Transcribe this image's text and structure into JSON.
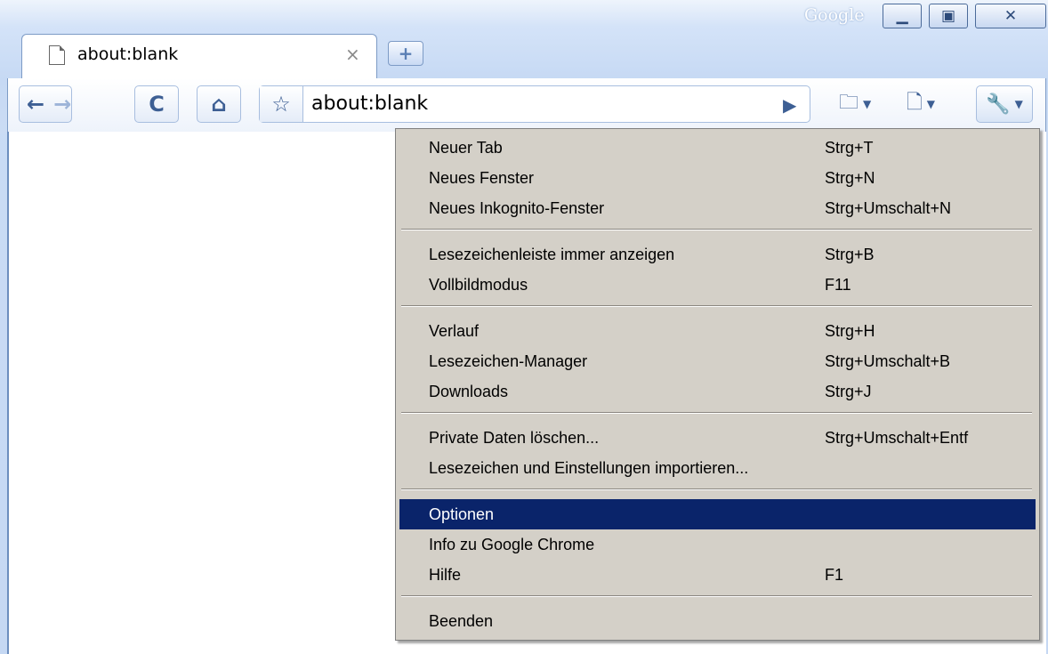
{
  "window": {
    "brand": "Google",
    "minimize_icon": "minimize-icon",
    "maximize_icon": "maximize-icon",
    "close_icon": "close-icon"
  },
  "tab": {
    "title": "about:blank",
    "close_glyph": "×",
    "new_tab_glyph": "+"
  },
  "toolbar": {
    "omnibox_value": "about:blank",
    "back_icon": "back-arrow-icon",
    "forward_icon": "forward-arrow-icon",
    "reload_icon": "reload-icon",
    "home_icon": "home-icon",
    "star_icon": "star-icon",
    "go_icon": "go-icon",
    "bookmark_icon": "bookmark-page-icon",
    "page_icon": "page-menu-icon",
    "wrench_icon": "wrench-icon"
  },
  "menu": {
    "items": [
      {
        "label": "Neuer Tab",
        "shortcut": "Strg+T"
      },
      {
        "label": "Neues Fenster",
        "shortcut": "Strg+N"
      },
      {
        "label": "Neues Inkognito-Fenster",
        "shortcut": "Strg+Umschalt+N"
      },
      {
        "label": "Lesezeichenleiste immer anzeigen",
        "shortcut": "Strg+B"
      },
      {
        "label": "Vollbildmodus",
        "shortcut": "F11"
      },
      {
        "label": "Verlauf",
        "shortcut": "Strg+H"
      },
      {
        "label": "Lesezeichen-Manager",
        "shortcut": "Strg+Umschalt+B"
      },
      {
        "label": "Downloads",
        "shortcut": "Strg+J"
      },
      {
        "label": "Private Daten löschen...",
        "shortcut": "Strg+Umschalt+Entf"
      },
      {
        "label": "Lesezeichen und Einstellungen importieren...",
        "shortcut": ""
      },
      {
        "label": "Optionen",
        "shortcut": "",
        "highlighted": true
      },
      {
        "label": "Info zu Google Chrome",
        "shortcut": ""
      },
      {
        "label": "Hilfe",
        "shortcut": "F1"
      },
      {
        "label": "Beenden",
        "shortcut": ""
      }
    ],
    "highlight_color": "#0a246a"
  }
}
